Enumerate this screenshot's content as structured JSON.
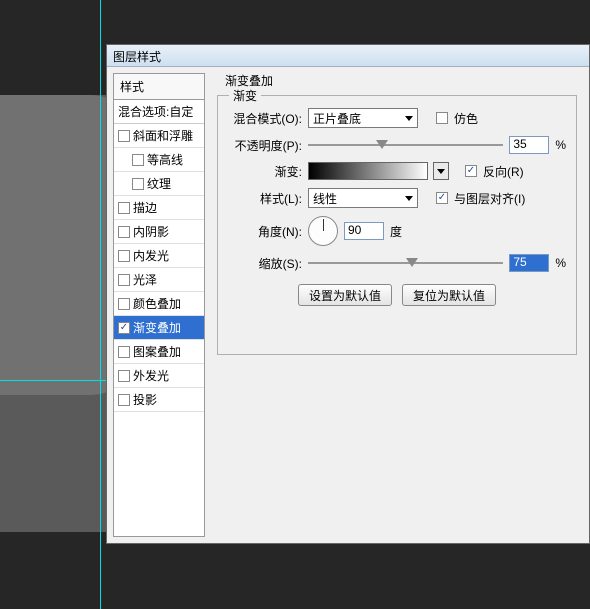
{
  "window": {
    "title": "图层样式"
  },
  "leftPanel": {
    "header": "样式",
    "blendingOptions": "混合选项:自定",
    "items": [
      {
        "label": "斜面和浮雕",
        "checked": false,
        "indent": false
      },
      {
        "label": "等高线",
        "checked": false,
        "indent": true
      },
      {
        "label": "纹理",
        "checked": false,
        "indent": true
      },
      {
        "label": "描边",
        "checked": false,
        "indent": false
      },
      {
        "label": "内阴影",
        "checked": false,
        "indent": false
      },
      {
        "label": "内发光",
        "checked": false,
        "indent": false
      },
      {
        "label": "光泽",
        "checked": false,
        "indent": false
      },
      {
        "label": "颜色叠加",
        "checked": false,
        "indent": false
      },
      {
        "label": "渐变叠加",
        "checked": true,
        "indent": false,
        "selected": true
      },
      {
        "label": "图案叠加",
        "checked": false,
        "indent": false
      },
      {
        "label": "外发光",
        "checked": false,
        "indent": false
      },
      {
        "label": "投影",
        "checked": false,
        "indent": false
      }
    ]
  },
  "rightPanel": {
    "groupTitle": "渐变叠加",
    "subgroupTitle": "渐变",
    "blendMode": {
      "label": "混合模式(O):",
      "value": "正片叠底"
    },
    "dither": {
      "label": "仿色",
      "checked": false
    },
    "opacity": {
      "label": "不透明度(P):",
      "value": "35",
      "unit": "%",
      "sliderPos": 35
    },
    "gradient": {
      "label": "渐变:"
    },
    "reverse": {
      "label": "反向(R)",
      "checked": true
    },
    "style": {
      "label": "样式(L):",
      "value": "线性"
    },
    "alignWithLayer": {
      "label": "与图层对齐(I)",
      "checked": true
    },
    "angle": {
      "label": "角度(N):",
      "value": "90",
      "unit": "度"
    },
    "scale": {
      "label": "缩放(S):",
      "value": "75",
      "unit": "%",
      "sliderPos": 50
    },
    "buttons": {
      "setDefault": "设置为默认值",
      "resetDefault": "复位为默认值"
    }
  }
}
